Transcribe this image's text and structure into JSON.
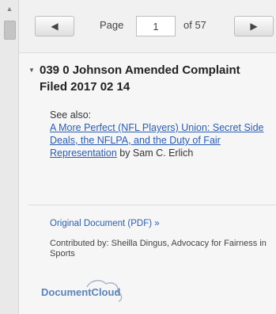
{
  "pager": {
    "page_label": "Page",
    "current_page": "1",
    "of_label": "of 57",
    "prev_icon": "left-triangle",
    "next_icon": "right-triangle"
  },
  "document": {
    "title": "039 0 Johnson Amended Complaint Filed 2017 02 14",
    "see_also_label": "See also:",
    "see_also_link": "A More Perfect (NFL Players) Union: Secret Side Deals, the NFLPA, and the Duty of Fair Representation",
    "see_also_by": " by Sam C. Erlich"
  },
  "footer": {
    "original_link": "Original Document (PDF) »",
    "contributed": "Contributed by: Sheilla Dingus, Advocacy for Fairness in Sports",
    "logo_text": "DocumentCloud"
  },
  "colors": {
    "link": "#2a5db0",
    "logo": "#5b83b8"
  }
}
